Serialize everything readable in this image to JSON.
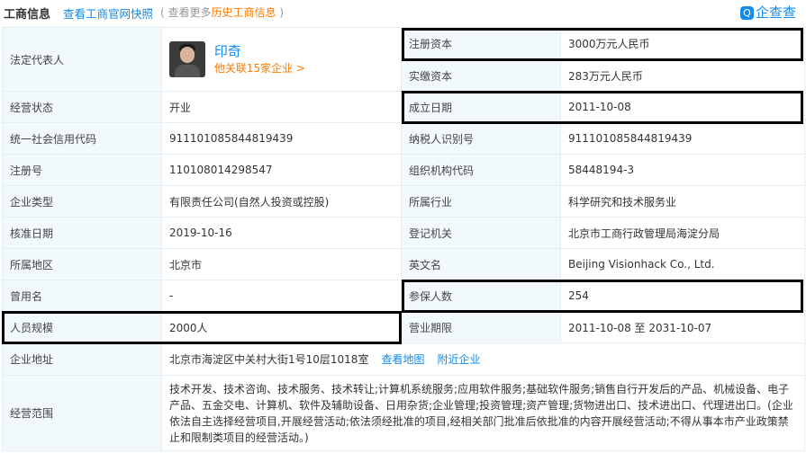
{
  "header": {
    "title": "工商信息",
    "link": "查看工商官网快照",
    "note_prefix": "( 查看更多",
    "note_link": "历史工商信息",
    "note_suffix": " )",
    "logo_mark": "Q",
    "logo_text": "企查查"
  },
  "legal_rep": {
    "label": "法定代表人",
    "name": "印奇",
    "related": "他关联15家企业 >"
  },
  "fields": {
    "reg_capital": {
      "label": "注册资本",
      "value": "3000万元人民币"
    },
    "paid_capital": {
      "label": "实缴资本",
      "value": "283万元人民币"
    },
    "status": {
      "label": "经营状态",
      "value": "开业"
    },
    "founded": {
      "label": "成立日期",
      "value": "2011-10-08"
    },
    "credit_code": {
      "label": "统一社会信用代码",
      "value": "911101085844819439"
    },
    "tax_id": {
      "label": "纳税人识别号",
      "value": "911101085844819439"
    },
    "reg_no": {
      "label": "注册号",
      "value": "110108014298547"
    },
    "org_code": {
      "label": "组织机构代码",
      "value": "58448194-3"
    },
    "company_type": {
      "label": "企业类型",
      "value": "有限责任公司(自然人投资或控股)"
    },
    "industry": {
      "label": "所属行业",
      "value": "科学研究和技术服务业"
    },
    "approval_date": {
      "label": "核准日期",
      "value": "2019-10-16"
    },
    "authority": {
      "label": "登记机关",
      "value": "北京市工商行政管理局海淀分局"
    },
    "region": {
      "label": "所属地区",
      "value": "北京市"
    },
    "english_name": {
      "label": "英文名",
      "value": "Beijing Visionhack Co., Ltd."
    },
    "former_name": {
      "label": "曾用名",
      "value": "-"
    },
    "insured": {
      "label": "参保人数",
      "value": "254"
    },
    "staff_size": {
      "label": "人员规模",
      "value": "2000人"
    },
    "term": {
      "label": "营业期限",
      "value": "2011-10-08 至 2031-10-07"
    },
    "address": {
      "label": "企业地址",
      "value": "北京市海淀区中关村大街1号10层1018室",
      "map_link": "查看地图",
      "nearby_link": "附近企业"
    },
    "scope": {
      "label": "经营范围",
      "value": "技术开发、技术咨询、技术服务、技术转让;计算机系统服务;应用软件服务;基础软件服务;销售自行开发后的产品、机械设备、电子产品、五金交电、计算机、软件及辅助设备、日用杂货;企业管理;投资管理;资产管理;货物进出口、技术进出口、代理进出口。(企业依法自主选择经营项目,开展经营活动;依法须经批准的项目,经相关部门批准后依批准的内容开展经营活动;不得从事本市产业政策禁止和限制类项目的经营活动。)"
    }
  }
}
